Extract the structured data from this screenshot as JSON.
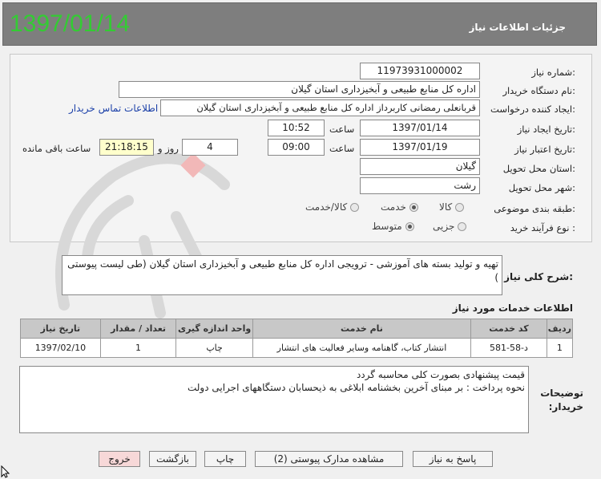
{
  "header": {
    "date": "1397/01/14",
    "title": "جزئیات اطلاعات نیاز"
  },
  "form": {
    "need_number_label": "شماره نیاز:",
    "need_number": "11973931000002",
    "buyer_label": "نام دستگاه خریدار:",
    "buyer": "اداره کل منابع طبیعی و آبخیزداری استان گیلان",
    "creator_label": "ایجاد کننده درخواست:",
    "creator": "قربانعلی رمضانی کاربرداز اداره کل منابع طبیعی و آبخیزداری استان گیلان",
    "contact_link": "اطلاعات تماس خریدار",
    "created_label": "تاریخ ایجاد نیاز:",
    "created_date": "1397/01/14",
    "time_label": "ساعت",
    "created_time": "10:52",
    "validity_label": "تاریخ اعتبار نیاز:",
    "validity_date": "1397/01/19",
    "validity_time": "09:00",
    "days": "4",
    "days_label": "روز و",
    "remaining_time": "21:18:15",
    "remaining_label": "ساعت باقی مانده",
    "province_label": "استان محل تحویل:",
    "province": "گیلان",
    "city_label": "شهر محل تحویل:",
    "city": "رشت",
    "category_label": "طبقه بندی موضوعی:",
    "category_options": [
      "کالا",
      "خدمت",
      "کالا/خدمت"
    ],
    "category_selected": "خدمت",
    "process_label": "نوع فرآیند خرید :",
    "process_options": [
      "جزیی",
      "متوسط"
    ],
    "process_selected": "متوسط"
  },
  "description": {
    "label": "شرح کلی نیاز:",
    "text": "تهیه و تولید بسته های آموزشی - ترویجی اداره کل منابع طبیعی و آبخیزداری استان گیلان (طی لیست پیوستی )"
  },
  "services": {
    "title": "اطلاعات خدمات مورد نیاز",
    "columns": [
      "ردیف",
      "کد خدمت",
      "نام خدمت",
      "واحد اندازه گیری",
      "تعداد / مقدار",
      "تاریخ نیاز"
    ],
    "rows": [
      [
        "1",
        "د-58-581",
        "انتشار کتاب، گاهنامه وسایر فعالیت های انتشار",
        "چاپ",
        "1",
        "1397/02/10"
      ]
    ]
  },
  "notes": {
    "label": "توضیحات خریدار:",
    "line1": "قیمت پیشنهادی بصورت کلی محاسبه گردد",
    "line2": "نحوه پرداخت : بر مبنای آخرین بخشنامه ابلاغی به ذیحسابان دستگاههای اجرایی دولت"
  },
  "buttons": {
    "reply": "پاسخ به نیاز",
    "attachments": "مشاهده مدارک پیوستی (2)",
    "print": "چاپ",
    "back": "بازگشت",
    "exit": "خروج"
  },
  "colors": {
    "header_bg": "#7e7e7e",
    "date_green": "#33cc33",
    "table_header": "#c8c8c8",
    "exit_btn": "#f7d8d8"
  }
}
